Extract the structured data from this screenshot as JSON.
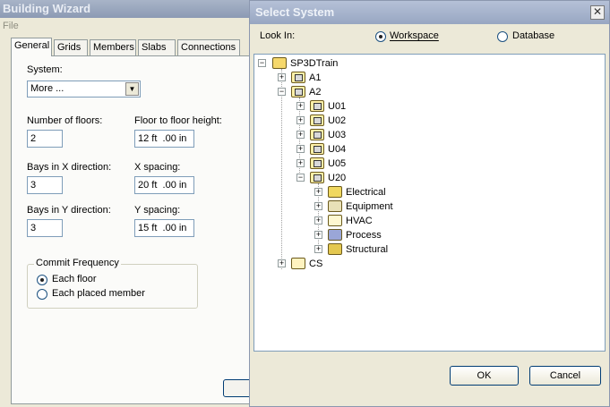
{
  "wizard": {
    "title": "Building Wizard",
    "menu_file": "File",
    "tabs": [
      "General",
      "Grids",
      "Members",
      "Slabs",
      "Connections"
    ],
    "system_label": "System:",
    "system_value": "More ...",
    "floors_label": "Number of floors:",
    "floors_value": "2",
    "floor_height_label": "Floor to floor height:",
    "floor_height_value": "12 ft  .00 in",
    "bays_x_label": "Bays in X direction:",
    "bays_x_value": "3",
    "x_spacing_label": "X spacing:",
    "x_spacing_value": "20 ft  .00 in",
    "bays_y_label": "Bays in Y direction:",
    "bays_y_value": "3",
    "y_spacing_label": "Y spacing:",
    "y_spacing_value": "15 ft  .00 in",
    "commit_label": "Commit Frequency",
    "commit_each_floor": "Each floor",
    "commit_each_member": "Each placed member"
  },
  "dialog": {
    "title": "Select System",
    "close_icon": "close-icon",
    "look_in_label": "Look In:",
    "workspace_label": "Workspace",
    "database_label": "Database",
    "ok_label": "OK",
    "cancel_label": "Cancel",
    "tree": {
      "root": "SP3DTrain",
      "a1": "A1",
      "a2": "A2",
      "u01": "U01",
      "u02": "U02",
      "u03": "U03",
      "u04": "U04",
      "u05": "U05",
      "u20": "U20",
      "electrical": "Electrical",
      "equipment": "Equipment",
      "hvac": "HVAC",
      "process": "Process",
      "structural": "Structural",
      "cs": "CS"
    }
  }
}
